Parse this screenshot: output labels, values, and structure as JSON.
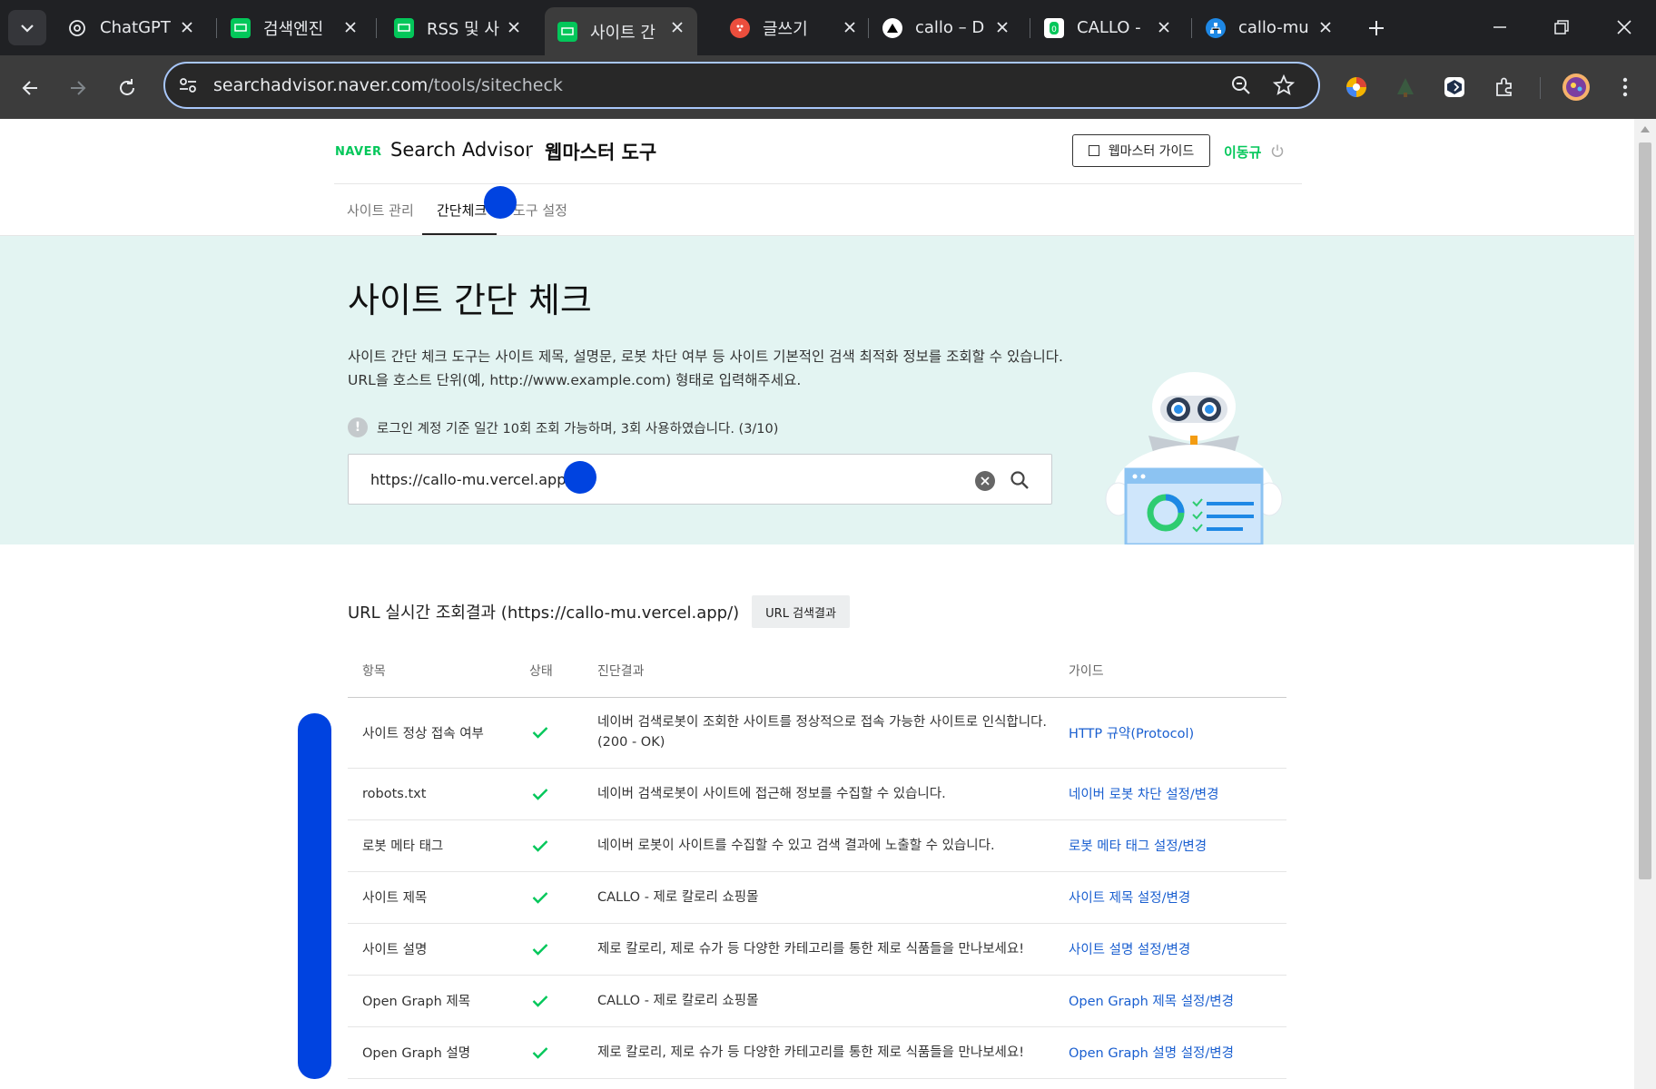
{
  "browser": {
    "tabs": [
      {
        "title": "ChatGPT",
        "icon": "chatgpt-icon",
        "active": false
      },
      {
        "title": "검색엔진",
        "icon": "naver-searchadvisor-icon",
        "active": false
      },
      {
        "title": "RSS 및 사",
        "icon": "naver-searchadvisor-icon",
        "active": false
      },
      {
        "title": "사이트 간",
        "icon": "naver-searchadvisor-icon",
        "active": true
      },
      {
        "title": "글쓰기",
        "icon": "tistory-icon",
        "active": false
      },
      {
        "title": "callo – D",
        "icon": "vercel-icon",
        "active": false
      },
      {
        "title": "CALLO -",
        "icon": "callo-icon",
        "active": false
      },
      {
        "title": "callo-mu",
        "icon": "sitemap-icon",
        "active": false
      }
    ],
    "url_host": "searchadvisor.naver.com",
    "url_path": "/tools/sitecheck"
  },
  "header": {
    "logo": "NAVER",
    "brand": "Search Advisor",
    "tool_title": "웹마스터 도구",
    "guide_button": "웹마스터 가이드",
    "user_name": "이동규"
  },
  "subnav": {
    "items": [
      "사이트 관리",
      "간단체크",
      "도구 설정"
    ],
    "active_index": 1
  },
  "hero": {
    "title": "사이트 간단 체크",
    "desc_line1": "사이트 간단 체크 도구는 사이트 제목, 설명문, 로봇 차단 여부 등 사이트 기본적인 검색 최적화 정보를 조회할 수 있습니다.",
    "desc_line2": "URL을 호스트 단위(예, http://www.example.com) 형태로 입력해주세요.",
    "notice": "로그인 계정 기준 일간 10회 조회 가능하며, 3회 사용하였습니다. (3/10)",
    "search_value": "https://callo-mu.vercel.app/"
  },
  "results": {
    "title": "URL 실시간 조회결과 (https://callo-mu.vercel.app/)",
    "url_button": "URL 검색결과",
    "columns": [
      "항목",
      "상태",
      "진단결과",
      "가이드"
    ],
    "rows": [
      {
        "item": "사이트 정상 접속 여부",
        "status": "ok",
        "result": "네이버 검색로봇이 조회한 사이트를 정상적으로 접속 가능한 사이트로 인식합니다.",
        "result2": "(200 - OK)",
        "guide": "HTTP 규약(Protocol)"
      },
      {
        "item": "robots.txt",
        "status": "ok",
        "result": "네이버 검색로봇이 사이트에 접근해 정보를 수집할 수 있습니다.",
        "result2": "",
        "guide": "네이버 로봇 차단 설정/변경"
      },
      {
        "item": "로봇 메타 태그",
        "status": "ok",
        "result": "네이버 로봇이 사이트를 수집할 수 있고 검색 결과에 노출할 수 있습니다.",
        "result2": "",
        "guide": "로봇 메타 태그 설정/변경"
      },
      {
        "item": "사이트 제목",
        "status": "ok",
        "result": "CALLO - 제로 칼로리 쇼핑몰",
        "result2": "",
        "guide": "사이트 제목 설정/변경"
      },
      {
        "item": "사이트 설명",
        "status": "ok",
        "result": "제로 칼로리, 제로 슈가 등 다양한 카테고리를 통한 제로 식품들을 만나보세요!",
        "result2": "",
        "guide": "사이트 설명 설정/변경"
      },
      {
        "item": "Open Graph 제목",
        "status": "ok",
        "result": "CALLO - 제로 칼로리 쇼핑몰",
        "result2": "",
        "guide": "Open Graph 제목 설정/변경"
      },
      {
        "item": "Open Graph 설명",
        "status": "ok",
        "result": "제로 칼로리, 제로 슈가 등 다양한 카테고리를 통한 제로 식품들을 만나보세요!",
        "result2": "",
        "guide": "Open Graph 설명 설정/변경"
      }
    ]
  },
  "colors": {
    "naver_green": "#03c75a",
    "hero_bg": "#e3f4f2",
    "link_blue": "#1a5fd0",
    "annotation_blue": "#0043e0"
  }
}
